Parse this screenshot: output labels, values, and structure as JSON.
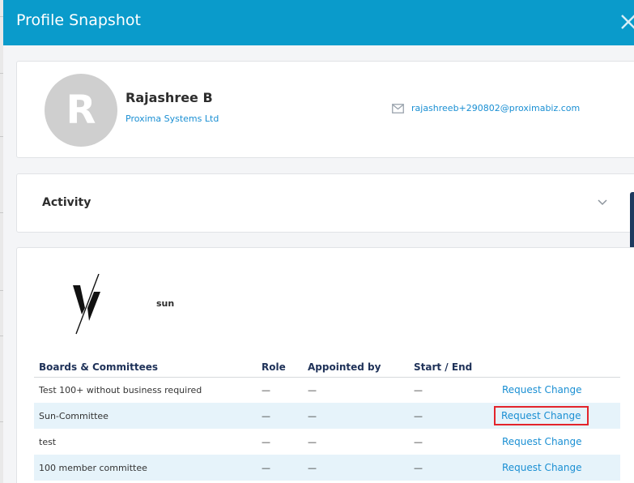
{
  "modal": {
    "title": "Profile Snapshot"
  },
  "profile": {
    "avatar_initial": "R",
    "name": "Rajashree B",
    "company": "Proxima Systems Ltd",
    "email": "rajashreeb+290802@proximabiz.com"
  },
  "activity": {
    "title": "Activity"
  },
  "board_section": {
    "company_name": "sun",
    "columns": [
      "Boards & Committees",
      "Role",
      "Appointed by",
      "Start / End",
      ""
    ],
    "rows": [
      {
        "name": "Test 100+ without business required",
        "role": "—",
        "appointed_by": "—",
        "start_end": "—",
        "action": "Request Change"
      },
      {
        "name": "Sun-Committee",
        "role": "—",
        "appointed_by": "—",
        "start_end": "—",
        "action": "Request Change"
      },
      {
        "name": "test",
        "role": "—",
        "appointed_by": "—",
        "start_end": "—",
        "action": "Request Change"
      },
      {
        "name": "100 member committee",
        "role": "—",
        "appointed_by": "—",
        "start_end": "—",
        "action": "Request Change"
      }
    ]
  },
  "icons": {
    "close": "close-icon",
    "mail": "mail-icon",
    "chevron": "chevron-down-icon"
  },
  "colors": {
    "header": "#0a9bcb",
    "link": "#1a8fd3",
    "highlight_border": "#e3242b",
    "stripe": "#e6f3fa",
    "table_header_text": "#1e3158"
  }
}
